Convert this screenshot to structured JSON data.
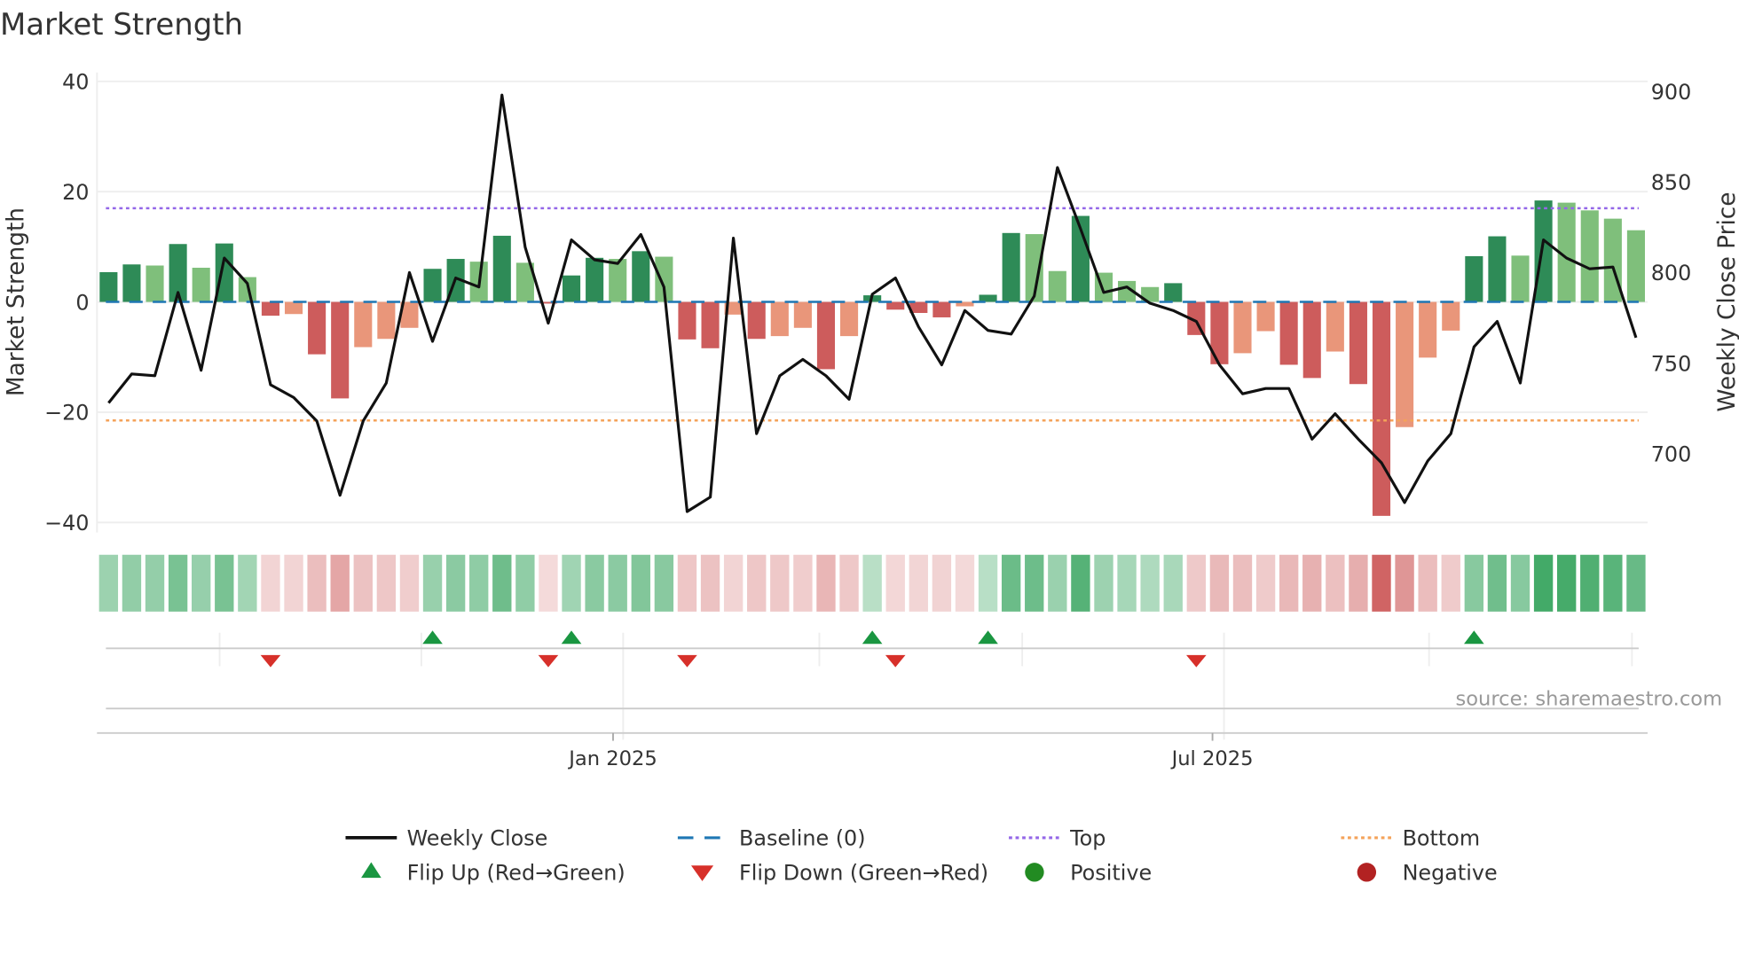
{
  "chart_data": {
    "type": "bar",
    "title": "Market Strength",
    "ylabel": "Market Strength",
    "y2label": "Weekly Close Price",
    "ylim": [
      -40,
      40
    ],
    "y2lim": [
      665,
      905
    ],
    "yticks": [
      "40",
      "20",
      "0",
      "−40",
      "−20"
    ],
    "yticks_values": [
      40,
      20,
      0,
      -40,
      -20
    ],
    "y2ticks": [
      "900",
      "850",
      "800",
      "750",
      "700"
    ],
    "y2ticks_values": [
      900,
      850,
      800,
      750,
      700
    ],
    "xticks": [
      {
        "label": "Jan 2025",
        "index": 22.3
      },
      {
        "label": "Jul 2025",
        "index": 48.2
      }
    ],
    "top_level": 17,
    "bottom_level": -21.5,
    "strength": [
      5.4,
      6.8,
      6.6,
      10.5,
      6.2,
      10.6,
      4.5,
      -2.5,
      -2.2,
      -9.5,
      -17.5,
      -8.2,
      -6.7,
      -4.7,
      6.0,
      7.8,
      7.3,
      12.0,
      7.1,
      -0.3,
      4.8,
      8.0,
      7.8,
      9.2,
      8.2,
      -6.8,
      -8.4,
      -2.3,
      -6.7,
      -6.2,
      -4.7,
      -12.2,
      -6.2,
      1.2,
      -1.4,
      -2.0,
      -2.8,
      -0.8,
      1.3,
      12.5,
      12.3,
      5.6,
      15.6,
      5.3,
      3.8,
      2.7,
      3.4,
      -6.0,
      -11.3,
      -9.3,
      -5.3,
      -11.4,
      -13.8,
      -9.0,
      -14.9,
      -38.8,
      -22.7,
      -10.1,
      -5.2,
      8.3,
      11.9,
      8.4,
      18.4,
      18.0,
      16.6,
      15.1,
      13.0
    ],
    "weekly_close": [
      728,
      744,
      743,
      789,
      746,
      808,
      794,
      738,
      731,
      718,
      677,
      718,
      739,
      800,
      762,
      797,
      792,
      898,
      814,
      772,
      818,
      807,
      805,
      821,
      792,
      668,
      676,
      819,
      711,
      743,
      752,
      743,
      730,
      788,
      797,
      770,
      749,
      779,
      768,
      766,
      787,
      858,
      824,
      789,
      792,
      783,
      779,
      773,
      749,
      733,
      736,
      736,
      708,
      722,
      708,
      695,
      673,
      696,
      711,
      759,
      773,
      739,
      818,
      808,
      802,
      803,
      764
    ],
    "flip_up_indices": [
      14,
      20,
      33,
      38,
      59
    ],
    "flip_down_indices": [
      7,
      19,
      25,
      34,
      47
    ],
    "colors": {
      "green_strong": "#2e8b57",
      "green_weak": "#7fbf7b",
      "red_strong": "#cd5c5c",
      "red_weak": "#e9967a",
      "line": "#111111",
      "baseline": "#1f77b4",
      "top": "#9467e8",
      "bottom": "#f4a259",
      "flip_up": "#1a9641",
      "flip_down": "#d7302a",
      "positive": "#228b22",
      "negative": "#b22222"
    },
    "legend": [
      {
        "label": "Weekly Close",
        "kind": "line"
      },
      {
        "label": "Baseline (0)",
        "kind": "dash"
      },
      {
        "label": "Top",
        "kind": "dot-top"
      },
      {
        "label": "Bottom",
        "kind": "dot-bottom"
      },
      {
        "label": "Flip Up (Red→Green)",
        "kind": "tri-up"
      },
      {
        "label": "Flip Down (Green→Red)",
        "kind": "tri-down"
      },
      {
        "label": "Positive",
        "kind": "circle-pos"
      },
      {
        "label": "Negative",
        "kind": "circle-neg"
      }
    ],
    "legend_placement": "bottom"
  },
  "source": "source: sharemaestro.com"
}
